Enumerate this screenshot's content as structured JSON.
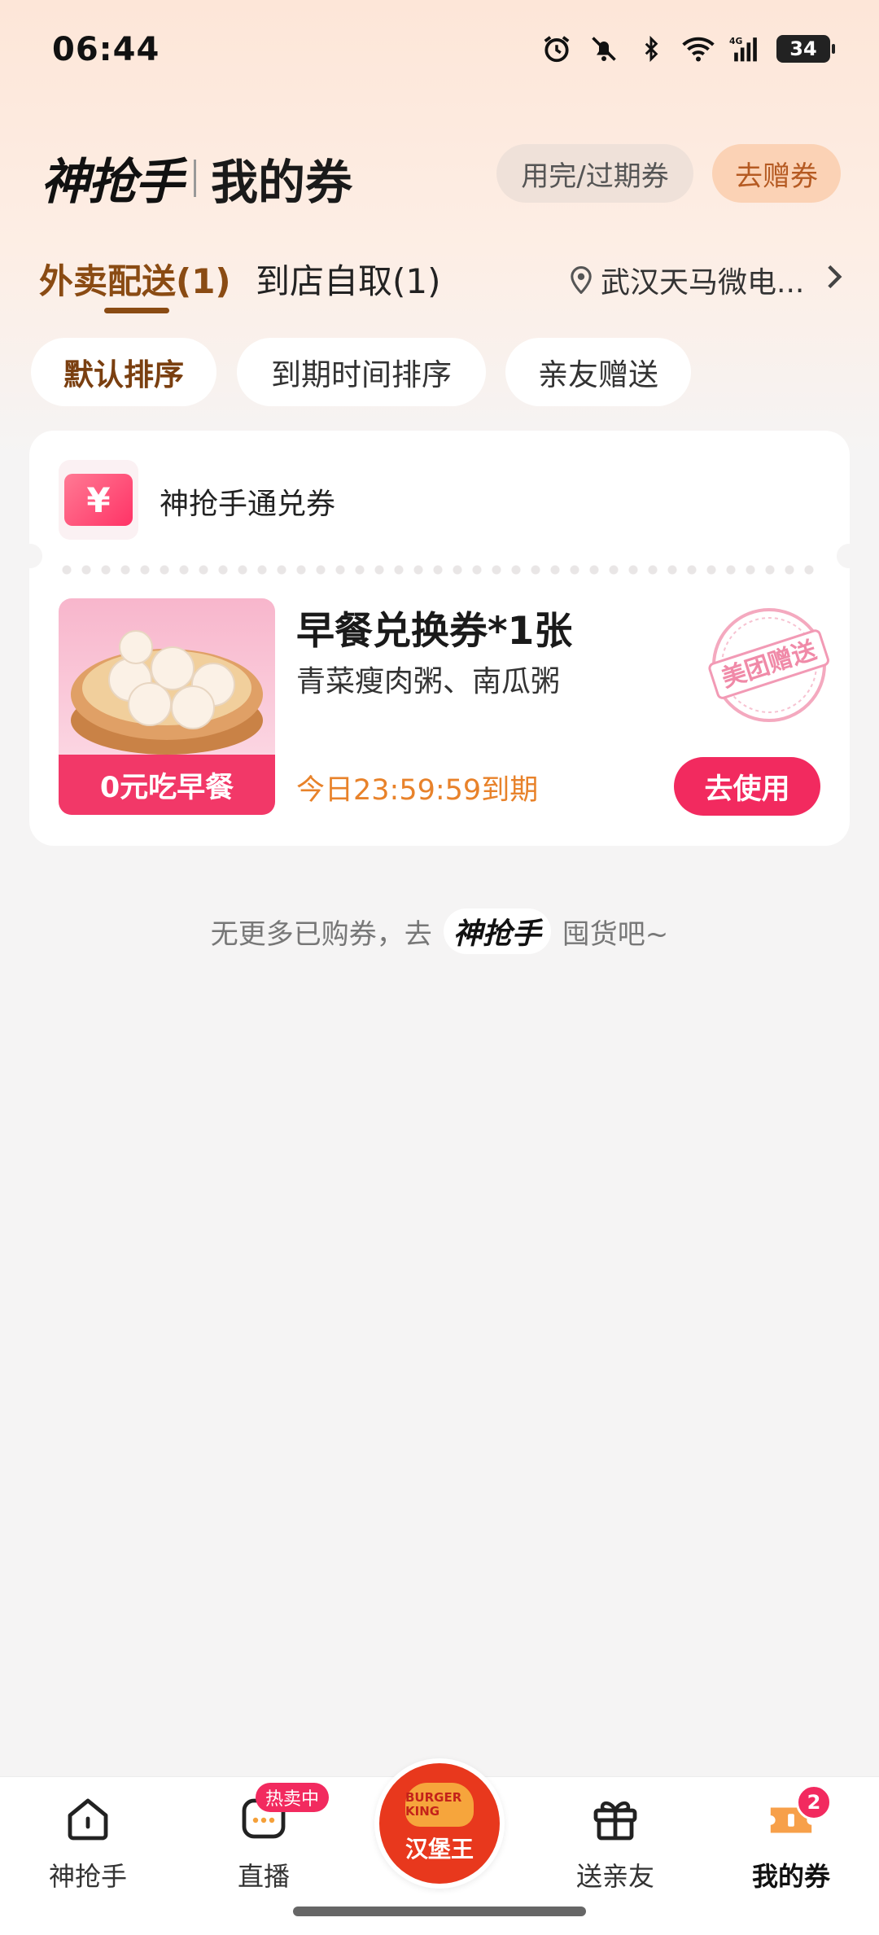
{
  "status_bar": {
    "time": "06:44",
    "battery": "34",
    "icons": [
      "alarm-icon",
      "mute-icon",
      "bluetooth-icon",
      "wifi-icon",
      "signal-4g-icon",
      "battery-icon"
    ]
  },
  "header": {
    "logo_text": "神抢手",
    "title": "我的券",
    "expired_button": "用完/过期券",
    "gift_button": "去赠券"
  },
  "tabs": [
    {
      "label": "外卖配送(1)",
      "active": true
    },
    {
      "label": "到店自取(1)",
      "active": false
    }
  ],
  "location": {
    "text": "武汉天马微电..."
  },
  "sort_chips": [
    {
      "label": "默认排序",
      "active": true
    },
    {
      "label": "到期时间排序",
      "active": false
    },
    {
      "label": "亲友赠送",
      "active": false
    }
  ],
  "coupon": {
    "type_icon_symbol": "¥",
    "type_name": "神抢手通兑券",
    "image_ribbon": "0元吃早餐",
    "title": "早餐兑换券*1张",
    "description": "青菜瘦肉粥、南瓜粥",
    "expiry": "今日23:59:59到期",
    "stamp": "美团赠送",
    "use_button": "去使用"
  },
  "footer_note": {
    "before": "无更多已购券，去",
    "logo": "神抢手",
    "after": "囤货吧~"
  },
  "bottom_nav": {
    "home": "神抢手",
    "live": "直播",
    "live_badge": "热卖中",
    "center_brand": "BURGER KING",
    "center_label": "汉堡王",
    "gift": "送亲友",
    "mine": "我的券",
    "mine_count": "2"
  },
  "colors": {
    "accent": "#f22a5f",
    "tab_active": "#8a4b13",
    "expiry": "#e8822a",
    "header_bg": "#fde6d8"
  }
}
